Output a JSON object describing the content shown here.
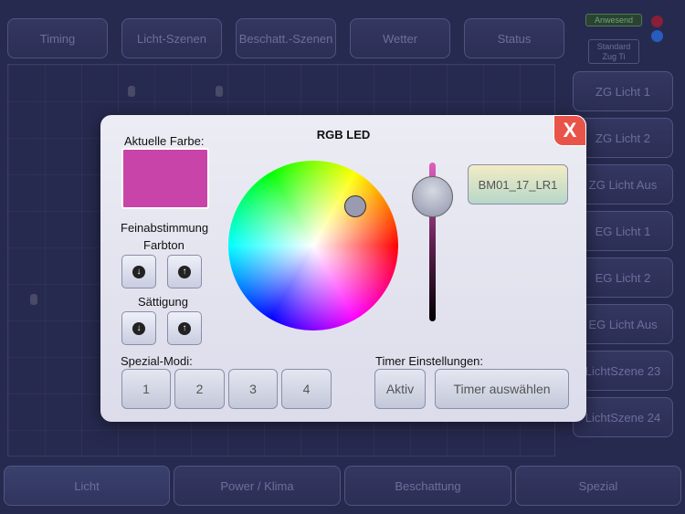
{
  "top_nav": [
    {
      "label": "Timing"
    },
    {
      "label": "Licht-Szenen"
    },
    {
      "label": "Beschatt.-Szenen"
    },
    {
      "label": "Wetter"
    },
    {
      "label": "Status"
    }
  ],
  "status": {
    "presence": "Anwesend",
    "mode_line1": "Standard",
    "mode_line2": "Zug Ti",
    "dot_colors": [
      "#a0203a",
      "#2a6ad8"
    ]
  },
  "side_scenes": [
    {
      "label": "ZG Licht 1"
    },
    {
      "label": "ZG Licht 2"
    },
    {
      "label": "ZG Licht Aus"
    },
    {
      "label": "EG Licht 1"
    },
    {
      "label": "EG Licht 2"
    },
    {
      "label": "EG Licht Aus"
    },
    {
      "label": "LichtSzene 23"
    },
    {
      "label": "LichtSzene 24"
    }
  ],
  "bottom_tabs": [
    {
      "label": "Licht",
      "active": true
    },
    {
      "label": "Power / Klima"
    },
    {
      "label": "Beschattung"
    },
    {
      "label": "Spezial"
    }
  ],
  "dialog": {
    "title": "RGB LED",
    "close_label": "X",
    "current_color_label": "Aktuelle Farbe:",
    "current_color": "#c844a8",
    "fine_tuning_label": "Feinabstimmung",
    "hue_label": "Farbton",
    "saturation_label": "Sättigung",
    "device_label": "BM01_17_LR1",
    "special_modes_label": "Spezial-Modi:",
    "special_modes": [
      "1",
      "2",
      "3",
      "4"
    ],
    "timer_label": "Timer Einstellungen:",
    "timer_active_label": "Aktiv",
    "timer_select_label": "Timer auswählen"
  }
}
